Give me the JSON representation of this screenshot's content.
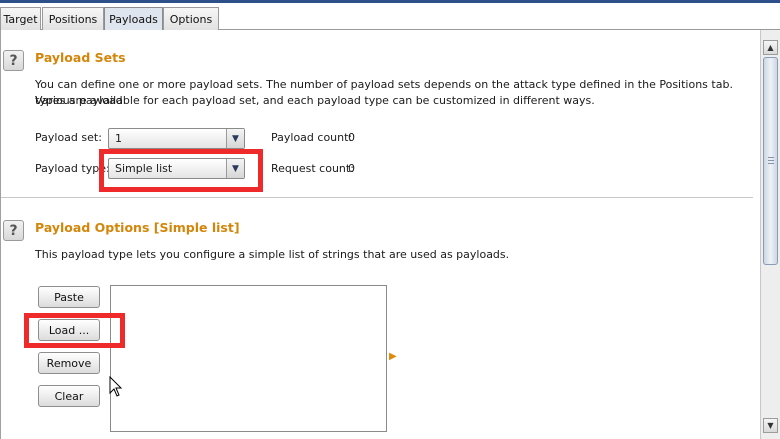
{
  "tabs": [
    {
      "label": "Target",
      "active": false
    },
    {
      "label": "Positions",
      "active": false
    },
    {
      "label": "Payloads",
      "active": true
    },
    {
      "label": "Options",
      "active": false
    }
  ],
  "payload_sets": {
    "help_glyph": "?",
    "title": "Payload Sets",
    "description_line1": "You can define one or more payload sets. The number of payload sets depends on the attack type defined in the Positions tab. Various payload",
    "description_line2": "types are available for each payload set, and each payload type can be customized in different ways.",
    "payload_set_label": "Payload set:",
    "payload_set_value": "1",
    "payload_type_label": "Payload type:",
    "payload_type_value": "Simple list",
    "payload_count_label": "Payload count:",
    "payload_count_value": "0",
    "request_count_label": "Request count:",
    "request_count_value": "0"
  },
  "payload_options": {
    "help_glyph": "?",
    "title": "Payload Options [Simple list]",
    "description": "This payload type lets you configure a simple list of strings that are used as payloads.",
    "buttons": {
      "paste": "Paste",
      "load": "Load ...",
      "remove": "Remove",
      "clear": "Clear"
    }
  },
  "icons": {
    "dropdown": "chevron-down-icon",
    "list_arrow": "triangle-right-icon",
    "scroll_up": "scroll-up-icon",
    "scroll_down": "scroll-down-icon"
  },
  "colors": {
    "section_title": "#d4860a",
    "highlight": "#ee2a2a",
    "window_accent": "#2d4f8a"
  }
}
